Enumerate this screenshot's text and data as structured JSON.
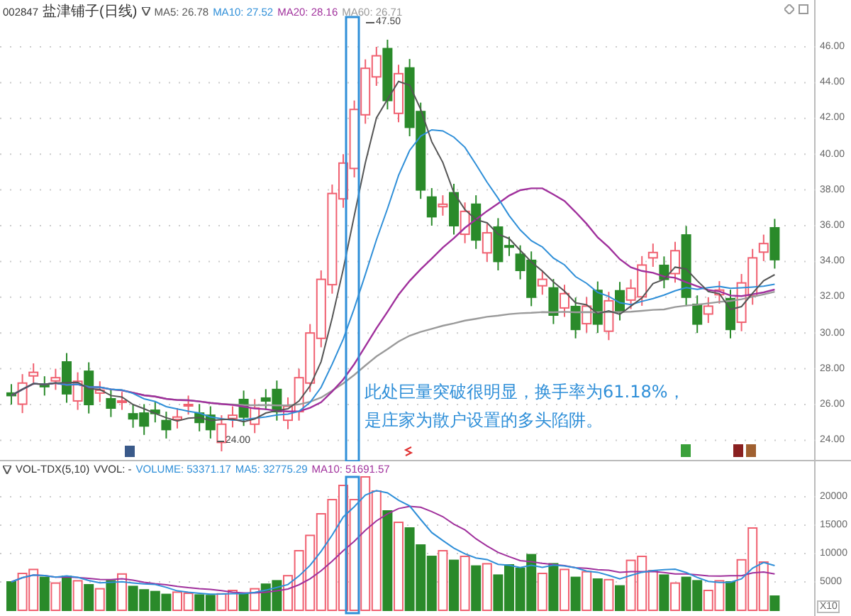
{
  "header": {
    "code": "002847",
    "name": "盐津铺子(日线)",
    "indicators": [
      {
        "label": "MA5: 26.78",
        "color": "#555555"
      },
      {
        "label": "MA10: 27.52",
        "color": "#2f8fd8"
      },
      {
        "label": "MA20: 28.16",
        "color": "#a0309c"
      },
      {
        "label": "MA60: 26.71",
        "color": "#9a9a9a"
      }
    ]
  },
  "price_axis": {
    "ticks": [
      "46.00",
      "44.00",
      "42.00",
      "40.00",
      "38.00",
      "36.00",
      "34.00",
      "32.00",
      "30.00",
      "28.00",
      "26.00",
      "24.00"
    ]
  },
  "high_label": "47.50",
  "low_label": "24.00",
  "annotation": {
    "lines": [
      "此处巨量突破很明显，换手率为61.18%，",
      "是庄家为散户设置的多头陷阱。"
    ]
  },
  "volume_header": {
    "name": "VOL-TDX(5,10)",
    "vvol": "VVOL: -",
    "indicators": [
      {
        "label": "VOLUME: 53371.17",
        "color": "#2f8fd8"
      },
      {
        "label": "MA5: 32775.29",
        "color": "#2f8fd8"
      },
      {
        "label": "MA10: 51691.57",
        "color": "#a0309c"
      }
    ]
  },
  "volume_axis": {
    "ticks": [
      "20000",
      "15000",
      "10000",
      "5000"
    ],
    "unit": "X10"
  }
}
